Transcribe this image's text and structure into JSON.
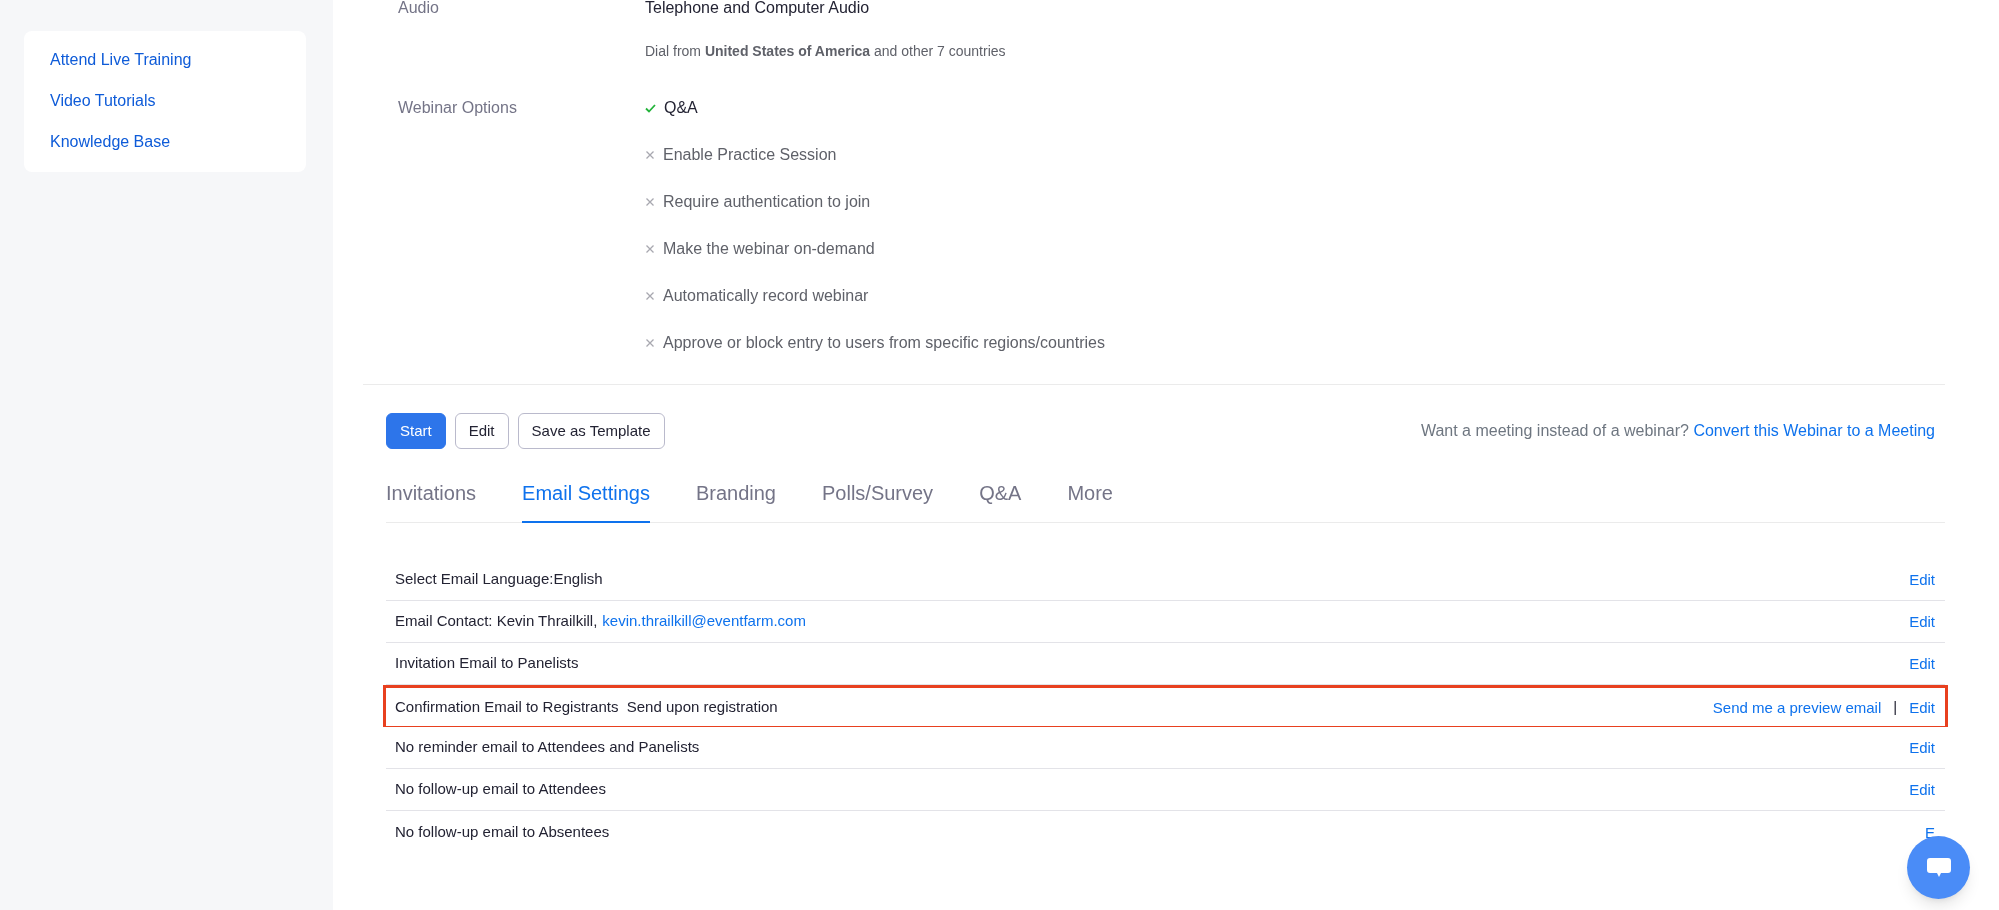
{
  "sidebar": {
    "links": [
      "Attend Live Training",
      "Video Tutorials",
      "Knowledge Base"
    ]
  },
  "details": [
    {
      "label": "Audio",
      "value": "Telephone and Computer Audio",
      "note": "Dial from **United States of America** and other 7 countries"
    },
    {
      "label": "Webinar Options",
      "options": [
        {
          "text": "Q&A",
          "checked": true
        },
        {
          "text": "Enable Practice Session",
          "checked": false
        },
        {
          "text": "Require authentication to join",
          "checked": false
        },
        {
          "text": "Make the webinar on-demand",
          "checked": false
        },
        {
          "text": "Automatically record webinar",
          "checked": false
        },
        {
          "text": "Approve or block entry to users from specific regions/countries",
          "checked": false
        }
      ]
    }
  ],
  "buttons": [
    {
      "label": "Start",
      "kind": "primary"
    },
    {
      "label": "Edit",
      "kind": "outline"
    },
    {
      "label": "Save as Template",
      "kind": "outline"
    }
  ],
  "convert": {
    "prompt": "Want a meeting instead of a webinar?",
    "link": "Convert this Webinar to a Meeting"
  },
  "tabs": [
    {
      "label": "Invitations",
      "selected": false
    },
    {
      "label": "Email Settings",
      "selected": true
    },
    {
      "label": "Branding",
      "selected": false
    },
    {
      "label": "Polls/Survey",
      "selected": false
    },
    {
      "label": "Q&A",
      "selected": false
    },
    {
      "label": "More",
      "selected": false
    }
  ],
  "email_rows": [
    {
      "text": "Select Email Language:English",
      "highlighted": false,
      "actions": [
        "Edit"
      ]
    },
    {
      "text": "Email Contact: Kevin Thrailkill,",
      "email": "kevin.thrailkill@eventfarm.com",
      "highlighted": false,
      "actions": [
        "Edit"
      ]
    },
    {
      "text": "Invitation Email to Panelists",
      "highlighted": false,
      "actions": [
        "Edit"
      ]
    },
    {
      "text": "Confirmation Email to Registrants  Send upon registration",
      "highlighted": true,
      "actions": [
        "Send me a preview email",
        "Edit"
      ],
      "separator": "|"
    },
    {
      "text": "No reminder email to Attendees and Panelists",
      "highlighted": false,
      "actions": [
        "Edit"
      ]
    },
    {
      "text": "No follow-up email to Attendees",
      "highlighted": false,
      "actions": [
        "Edit"
      ]
    },
    {
      "text": "No follow-up email to Absentees",
      "highlighted": false,
      "actions": [
        "E"
      ]
    }
  ]
}
